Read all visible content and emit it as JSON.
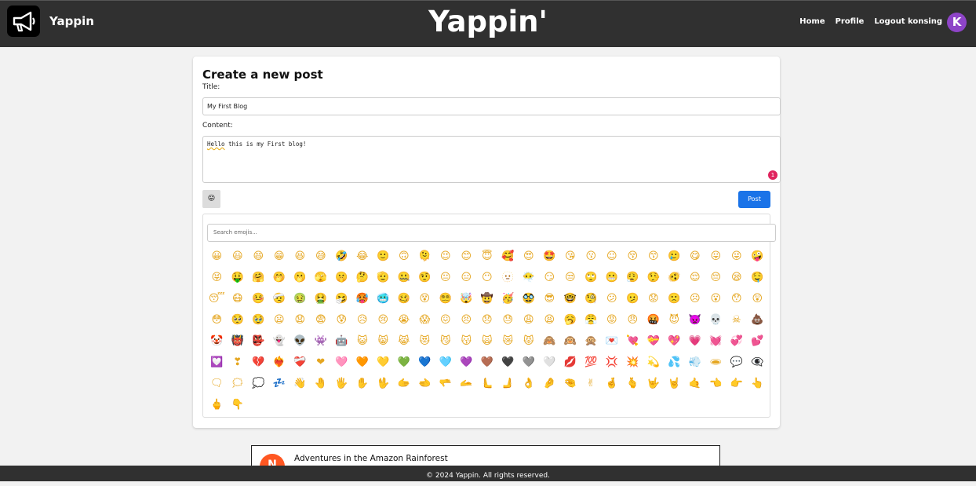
{
  "header": {
    "brand": "Yappin",
    "title": "Yappin'",
    "nav": {
      "home": "Home",
      "profile": "Profile",
      "logout": "Logout konsing"
    },
    "avatar_initial": "K"
  },
  "form": {
    "heading": "Create a new post",
    "title_label": "Title:",
    "title_value": "My First Blog",
    "content_label": "Content:",
    "content_word_flagged": "Hello",
    "content_rest": " this is my First blog!",
    "error_count": "1",
    "emoji_toggle_icon": "smiley-icon",
    "post_button": "Post"
  },
  "emoji_picker": {
    "search_placeholder": "Search emojis...",
    "emojis": [
      "😀",
      "😃",
      "😄",
      "😁",
      "😆",
      "😅",
      "🤣",
      "😂",
      "🙂",
      "🙃",
      "🫠",
      "😉",
      "😊",
      "😇",
      "🥰",
      "😍",
      "🤩",
      "😘",
      "😗",
      "☺",
      "😚",
      "😙",
      "🥲",
      "😋",
      "😛",
      "😜",
      "🤪",
      "😝",
      "🤑",
      "🤗",
      "🤭",
      "🫢",
      "🫣",
      "🤫",
      "🤔",
      "🫡",
      "🤐",
      "🤨",
      "😐",
      "😑",
      "😶",
      "🫥",
      "😶‍🌫️",
      "😏",
      "😒",
      "🙄",
      "😬",
      "😮‍💨",
      "🤥",
      "🫨",
      "😌",
      "😔",
      "😪",
      "🤤",
      "😴",
      "😷",
      "🤒",
      "🤕",
      "🤢",
      "🤮",
      "🤧",
      "🥵",
      "🥶",
      "🥴",
      "😵",
      "😵‍💫",
      "🤯",
      "🤠",
      "🥳",
      "🥸",
      "😎",
      "🤓",
      "🧐",
      "😕",
      "🫤",
      "😟",
      "🙁",
      "☹",
      "😮",
      "😯",
      "😲",
      "😳",
      "🥺",
      "🥹",
      "😦",
      "😧",
      "😨",
      "😰",
      "😥",
      "😢",
      "😭",
      "😱",
      "😖",
      "😣",
      "😞",
      "😓",
      "😩",
      "😫",
      "🥱",
      "😤",
      "😡",
      "😠",
      "🤬",
      "😈",
      "👿",
      "💀",
      "☠",
      "💩",
      "🤡",
      "👹",
      "👺",
      "👻",
      "👽",
      "👾",
      "🤖",
      "😺",
      "😸",
      "😹",
      "😻",
      "😼",
      "😽",
      "🙀",
      "😿",
      "😾",
      "🙈",
      "🙉",
      "🙊",
      "💌",
      "💘",
      "💝",
      "💖",
      "💗",
      "💓",
      "💞",
      "💕",
      "💟",
      "❣",
      "💔",
      "❤‍🔥",
      "❤‍🩹",
      "❤",
      "🩷",
      "🧡",
      "💛",
      "💚",
      "💙",
      "🩵",
      "💜",
      "🤎",
      "🖤",
      "🩶",
      "🤍",
      "💋",
      "💯",
      "💢",
      "💥",
      "💫",
      "💦",
      "💨",
      "🕳",
      "💬",
      "👁‍🗨",
      "🗨",
      "🗯",
      "💭",
      "💤",
      "👋",
      "🤚",
      "🖐",
      "✋",
      "🖖",
      "🫱",
      "🫲",
      "🫳",
      "🫴",
      "🫷",
      "🫸",
      "👌",
      "🤌",
      "🤏",
      "✌",
      "🤞",
      "🫰",
      "🤟",
      "🤘",
      "🤙",
      "👈",
      "👉",
      "👆",
      "🖕",
      "👇"
    ]
  },
  "below_post": {
    "avatar_initial": "N",
    "title": "Adventures in the Amazon Rainforest"
  },
  "footer": {
    "text": "© 2024 Yappin. All rights reserved."
  },
  "colors": {
    "topbar": "#303030",
    "post_button": "#1a73e8",
    "avatar": "#8e44c7",
    "error_badge": "#e0245e",
    "below_avatar": "#ff5722"
  }
}
